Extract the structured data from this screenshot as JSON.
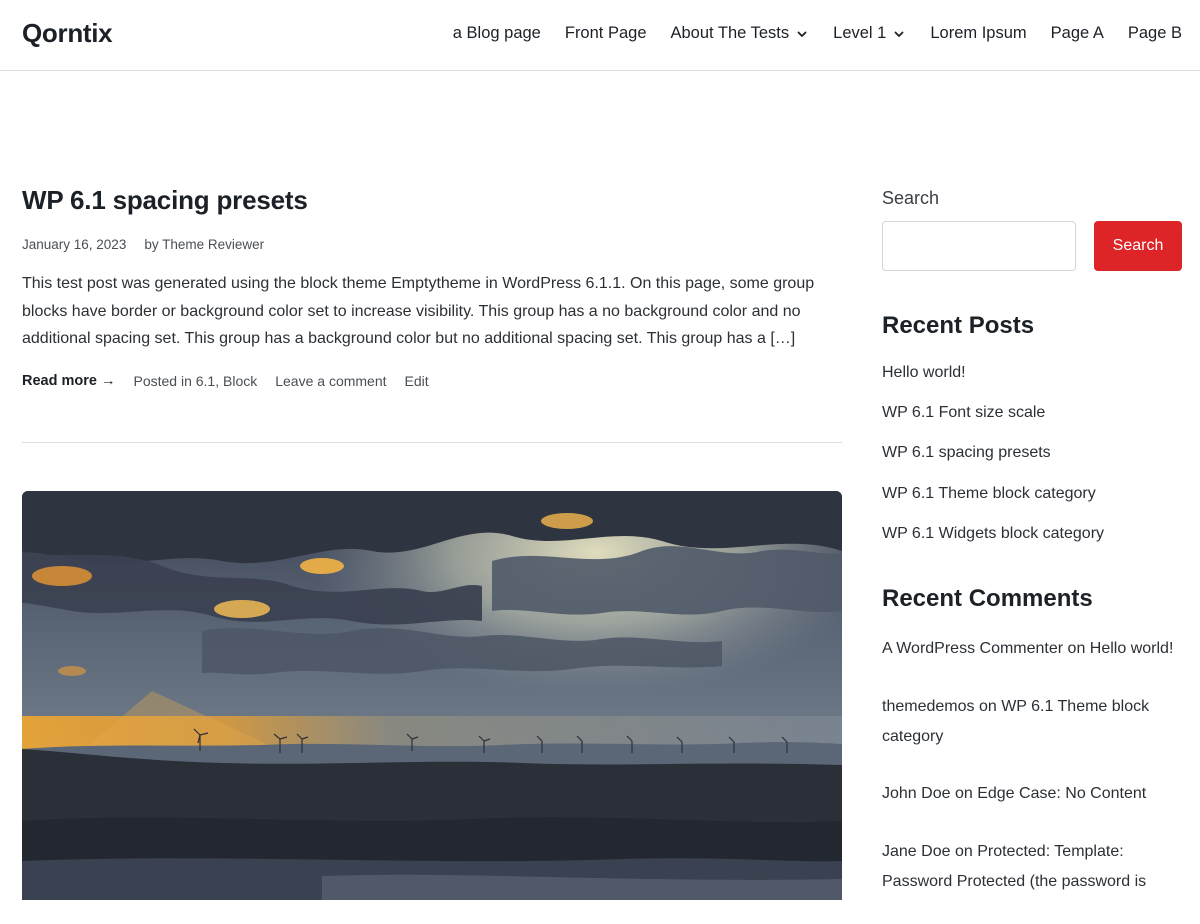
{
  "site": {
    "title": "Qorntix"
  },
  "nav": {
    "items": [
      {
        "label": "a Blog page",
        "has_dropdown": false
      },
      {
        "label": "Front Page",
        "has_dropdown": false
      },
      {
        "label": "About The Tests",
        "has_dropdown": true
      },
      {
        "label": "Level 1",
        "has_dropdown": true
      },
      {
        "label": "Lorem Ipsum",
        "has_dropdown": false
      },
      {
        "label": "Page A",
        "has_dropdown": false
      },
      {
        "label": "Page B",
        "has_dropdown": false
      }
    ]
  },
  "post": {
    "title": "WP 6.1 spacing presets",
    "date": "January 16, 2023",
    "author": "by Theme Reviewer",
    "excerpt": "This test post was generated using the block theme Emptytheme in WordPress 6.1.1. On this page, some group blocks have border or background color set to increase visibility. This group has a no background color and no additional spacing set. This group has a background color but no additional spacing set. This group has a […]",
    "read_more": "Read more →",
    "posted_in_prefix": "Posted in",
    "categories": "6.1, Block",
    "leave_comment": "Leave a comment",
    "edit": "Edit"
  },
  "sidebar": {
    "search_label": "Search",
    "search_placeholder": "",
    "search_button": "Search",
    "recent_posts_title": "Recent Posts",
    "recent_posts": [
      "Hello world!",
      "WP 6.1 Font size scale",
      "WP 6.1 spacing presets",
      "WP 6.1 Theme block category",
      "WP 6.1 Widgets block category"
    ],
    "recent_comments_title": "Recent Comments",
    "recent_comments": [
      {
        "author": "A WordPress Commenter",
        "on": "on",
        "post": "Hello world!"
      },
      {
        "author": "themedemos",
        "on": "on",
        "post": "WP 6.1 Theme block category"
      },
      {
        "author": "John Doe",
        "on": "on",
        "post": "Edge Case: No Content"
      },
      {
        "author": "Jane Doe",
        "on": "on",
        "post": "Protected: Template: Password Protected (the password is"
      }
    ]
  },
  "colors": {
    "accent": "#dd2427",
    "text": "#1c2127",
    "border": "#dcdcdc"
  },
  "icons": {
    "dropdown": "chevron-down-icon"
  }
}
